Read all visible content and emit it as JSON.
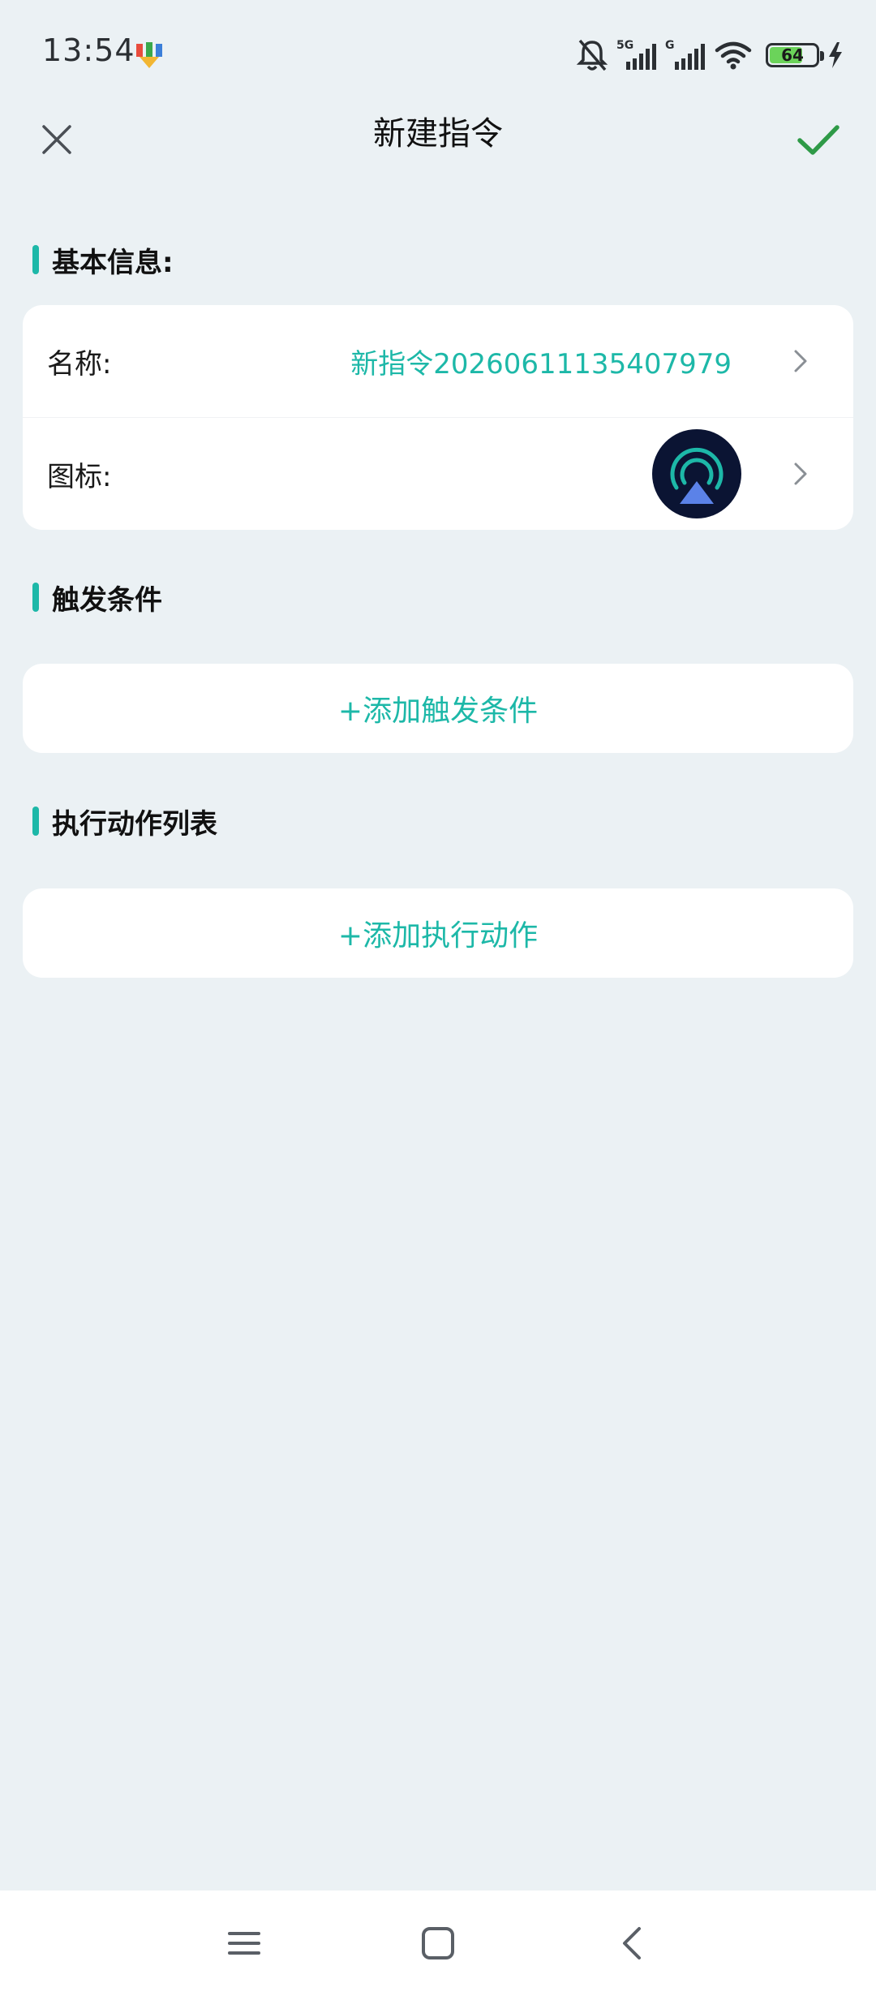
{
  "status_bar": {
    "time": "13:54",
    "battery_level": "64",
    "network_1": "5G",
    "network_2": "G",
    "icons": [
      "app-download-icon",
      "mute-bell-icon",
      "signal-icon",
      "signal-icon",
      "wifi-icon",
      "battery-icon",
      "charging-icon"
    ]
  },
  "top_bar": {
    "title": "新建指令",
    "close_icon": "close-icon",
    "confirm_icon": "check-icon"
  },
  "basic_info": {
    "section_title": "基本信息:",
    "name_label": "名称:",
    "name_value": "新指令20260611135407979",
    "icon_label": "图标:",
    "icon_name": "broadcast-radar-icon"
  },
  "trigger": {
    "section_title": "触发条件",
    "add_label": "+添加触发条件"
  },
  "actions": {
    "section_title": "执行动作列表",
    "add_label": "+添加执行动作"
  },
  "nav_bar": {
    "icons": [
      "menu-icon",
      "home-icon",
      "back-icon"
    ]
  },
  "colors": {
    "accent": "#1db8a8",
    "confirm": "#2e9a47",
    "background": "#ebf1f4",
    "card": "#ffffff"
  }
}
